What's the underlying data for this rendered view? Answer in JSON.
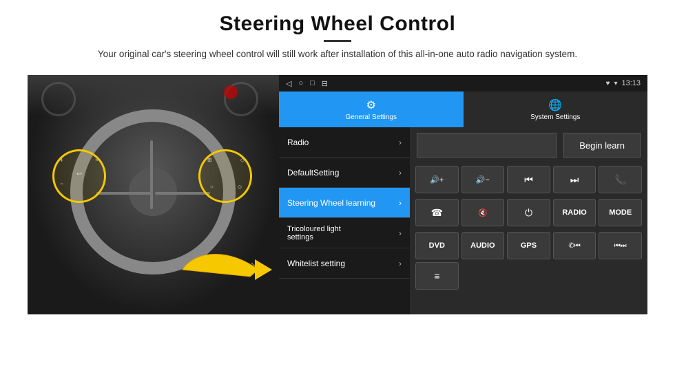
{
  "header": {
    "title": "Steering Wheel Control",
    "subtitle": "Your original car's steering wheel control will still work after installation of this all-in-one auto radio navigation system."
  },
  "screen": {
    "status_bar": {
      "nav_icons": [
        "◁",
        "○",
        "□",
        "⊟"
      ],
      "right_icons": [
        "♥",
        "▾"
      ],
      "time": "13:13"
    },
    "tabs": [
      {
        "label": "General Settings",
        "active": true
      },
      {
        "label": "System Settings",
        "active": false
      }
    ],
    "menu_items": [
      {
        "label": "Radio",
        "active": false
      },
      {
        "label": "DefaultSetting",
        "active": false
      },
      {
        "label": "Steering Wheel learning",
        "active": true
      },
      {
        "label": "Tricoloured light settings",
        "active": false
      },
      {
        "label": "Whitelist setting",
        "active": false
      }
    ],
    "begin_learn_button": "Begin learn",
    "control_buttons": {
      "row1": [
        {
          "icon": "🔊+",
          "type": "text"
        },
        {
          "icon": "🔊-",
          "type": "text"
        },
        {
          "icon": "⏮",
          "type": "text"
        },
        {
          "icon": "⏭",
          "type": "text"
        },
        {
          "icon": "✆",
          "type": "text"
        }
      ],
      "row2": [
        {
          "icon": "☏",
          "type": "text"
        },
        {
          "icon": "🔇",
          "type": "text"
        },
        {
          "icon": "⏻",
          "type": "text"
        },
        {
          "icon": "RADIO",
          "type": "text"
        },
        {
          "icon": "MODE",
          "type": "text"
        }
      ],
      "row3": [
        {
          "icon": "DVD",
          "type": "text"
        },
        {
          "icon": "AUDIO",
          "type": "text"
        },
        {
          "icon": "GPS",
          "type": "text"
        },
        {
          "icon": "✆⏮",
          "type": "text"
        },
        {
          "icon": "⏮⏭",
          "type": "text"
        }
      ],
      "row4": [
        {
          "icon": "📋",
          "type": "text"
        }
      ]
    }
  }
}
